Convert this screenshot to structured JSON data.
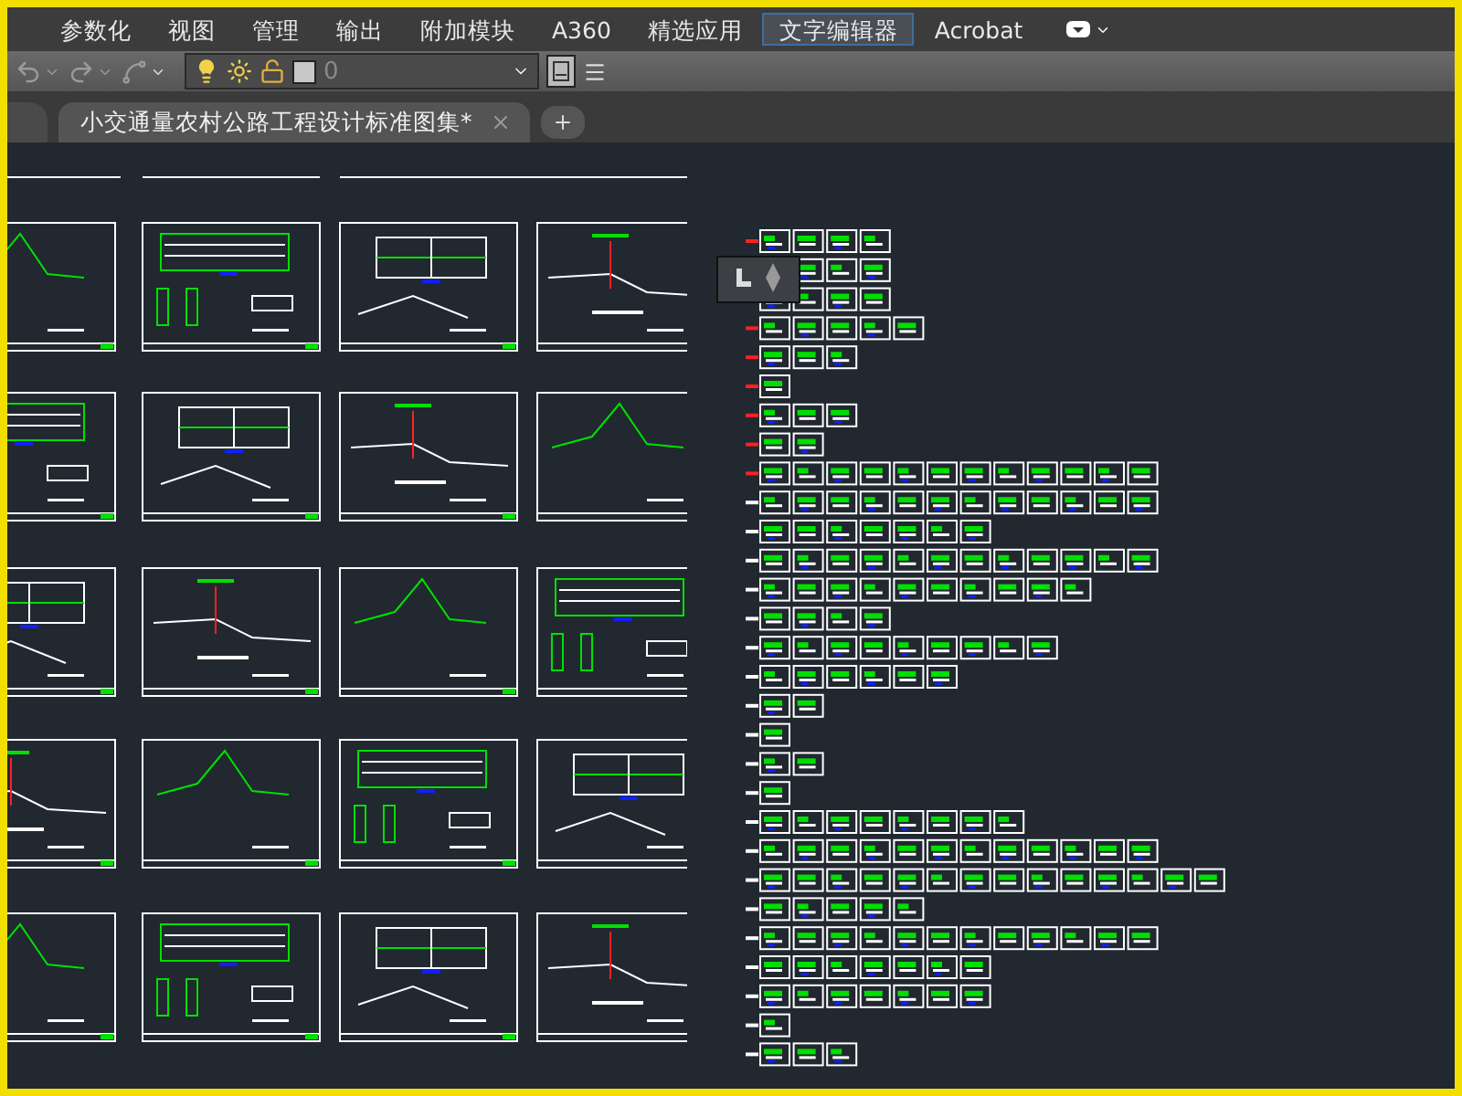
{
  "menu": [
    {
      "label": "参数化",
      "selected": false
    },
    {
      "label": "视图",
      "selected": false
    },
    {
      "label": "管理",
      "selected": false
    },
    {
      "label": "输出",
      "selected": false
    },
    {
      "label": "附加模块",
      "selected": false
    },
    {
      "label": "A360",
      "selected": false
    },
    {
      "label": "精选应用",
      "selected": false
    },
    {
      "label": "文字编辑器",
      "selected": true
    },
    {
      "label": "Acrobat",
      "selected": false
    }
  ],
  "layer_combo": {
    "value": "0"
  },
  "document_tabs": [
    {
      "label": "小交通量农村公路工程设计标准图集*",
      "selected": true
    }
  ]
}
